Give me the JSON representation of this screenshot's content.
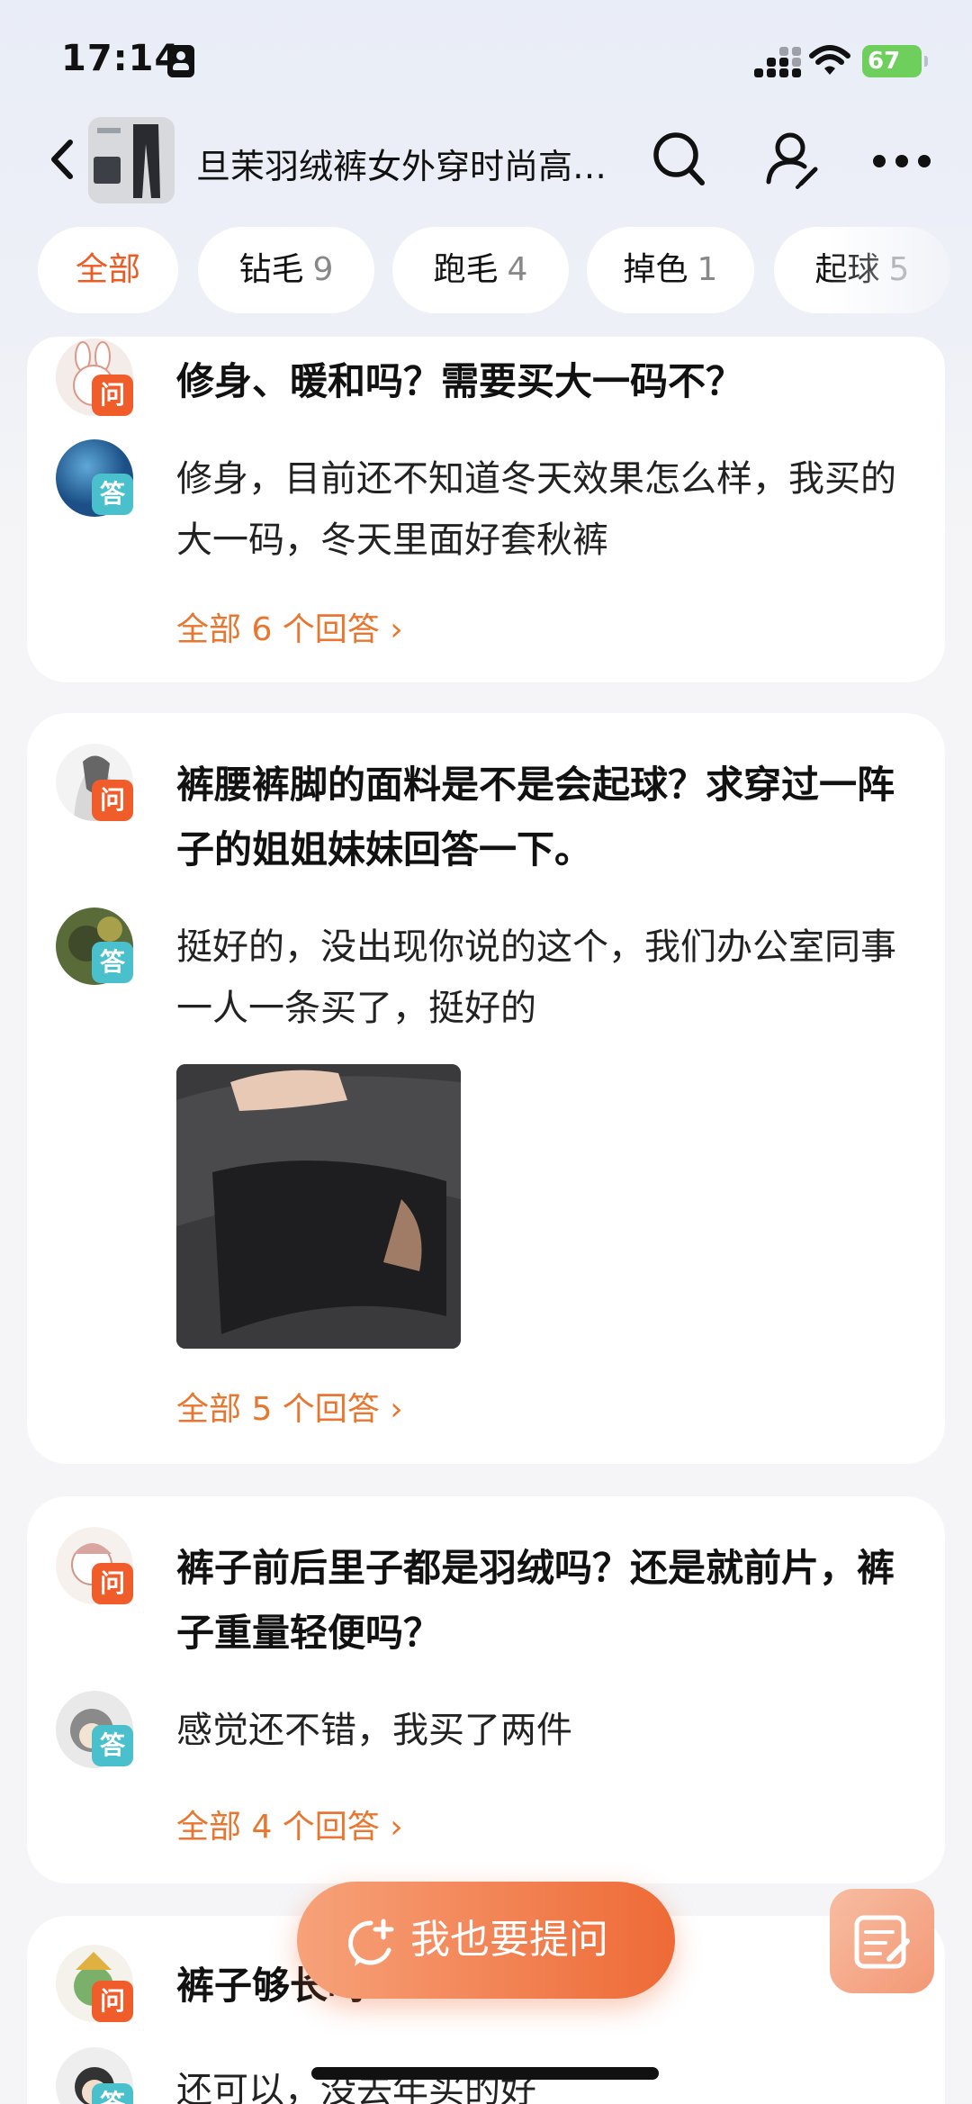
{
  "status_bar": {
    "time": "17:14",
    "battery": "67"
  },
  "header": {
    "title": "旦茉羽绒裤女外穿时尚高…"
  },
  "filters": [
    {
      "label": "全部",
      "count": ""
    },
    {
      "label": "钻毛",
      "count": "9"
    },
    {
      "label": "跑毛",
      "count": "4"
    },
    {
      "label": "掉色",
      "count": "1"
    },
    {
      "label": "起球",
      "count": "5"
    }
  ],
  "badges": {
    "question": "问",
    "answer": "答"
  },
  "qa": [
    {
      "question": "修身、暖和吗？需要买大一码不？",
      "answer": "修身，目前还不知道冬天效果怎么样，我买的大一码，冬天里面好套秋裤",
      "all_answers": "全部 6 个回答 ›"
    },
    {
      "question": "裤腰裤脚的面料是不是会起球？求穿过一阵子的姐姐妹妹回答一下。",
      "answer": "挺好的，没出现你说的这个，我们办公室同事一人一条买了，挺好的",
      "all_answers": "全部 5 个回答 ›"
    },
    {
      "question": "裤子前后里子都是羽绒吗？还是就前片，裤子重量轻便吗？",
      "answer": "感觉还不错，我买了两件",
      "all_answers": "全部 4 个回答 ›"
    },
    {
      "question": "裤子够长吗",
      "answer": "还可以，没去年买的好"
    }
  ],
  "ask_button": {
    "label": "我也要提问"
  },
  "colors": {
    "accent": "#f05a22",
    "answer_badge": "#49c0cc",
    "link": "#e8762f"
  }
}
